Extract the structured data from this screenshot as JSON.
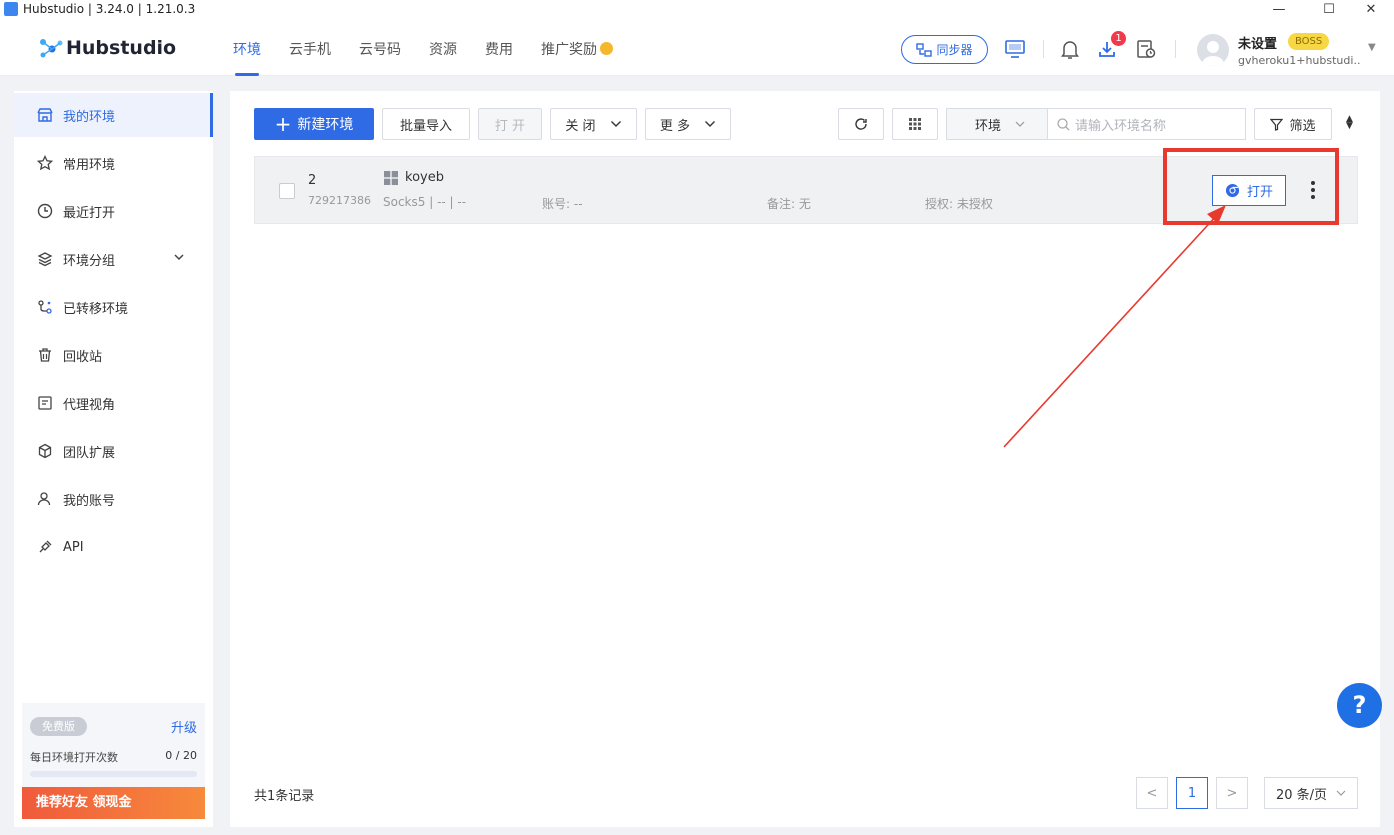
{
  "window": {
    "title": "Hubstudio | 3.24.0 | 1.21.0.3",
    "controls": [
      "—",
      "☐",
      "✕"
    ]
  },
  "header": {
    "logo": "Hubstudio",
    "nav": [
      "环境",
      "云手机",
      "云号码",
      "资源",
      "费用",
      "推广奖励"
    ],
    "active_nav": "环境",
    "sync_button": "同步器",
    "notification_badge": "1",
    "user": {
      "name": "未设置",
      "tier": "BOSS",
      "email": "gvheroku1+hubstudi..."
    }
  },
  "sidebar": {
    "items": [
      "我的环境",
      "常用环境",
      "最近打开",
      "环境分组",
      "已转移环境",
      "回收站",
      "代理视角",
      "团队扩展",
      "我的账号",
      "API"
    ],
    "active": "我的环境",
    "plan": {
      "tag": "免费版",
      "upgrade": "升级",
      "daily_label": "每日环境打开次数",
      "daily_value": "0 / 20",
      "daily_used": 0,
      "daily_total": 20,
      "referral": "推荐好友  领现金"
    }
  },
  "toolbar": {
    "new_env": "新建环境",
    "batch_import": "批量导入",
    "open": "打 开",
    "close": "关 闭",
    "more": "更 多",
    "env_select": "环境",
    "search_placeholder": "请输入环境名称",
    "filter": "筛选"
  },
  "rows": [
    {
      "number": "2",
      "id": "729217386",
      "name": "koyeb",
      "proxy": "Socks5 | -- | --",
      "account": "账号: --",
      "note": "备注: 无",
      "auth": "授权: 未授权",
      "open_button": "打开"
    }
  ],
  "footer": {
    "total": "共1条记录",
    "prev": "<",
    "current_page": "1",
    "next": ">",
    "page_size": "20 条/页"
  },
  "help_button": "?",
  "colors": {
    "accent": "#2f6be4",
    "highlight": "#e8392f",
    "badge": "#f0394a",
    "boss": "#f7d743"
  }
}
